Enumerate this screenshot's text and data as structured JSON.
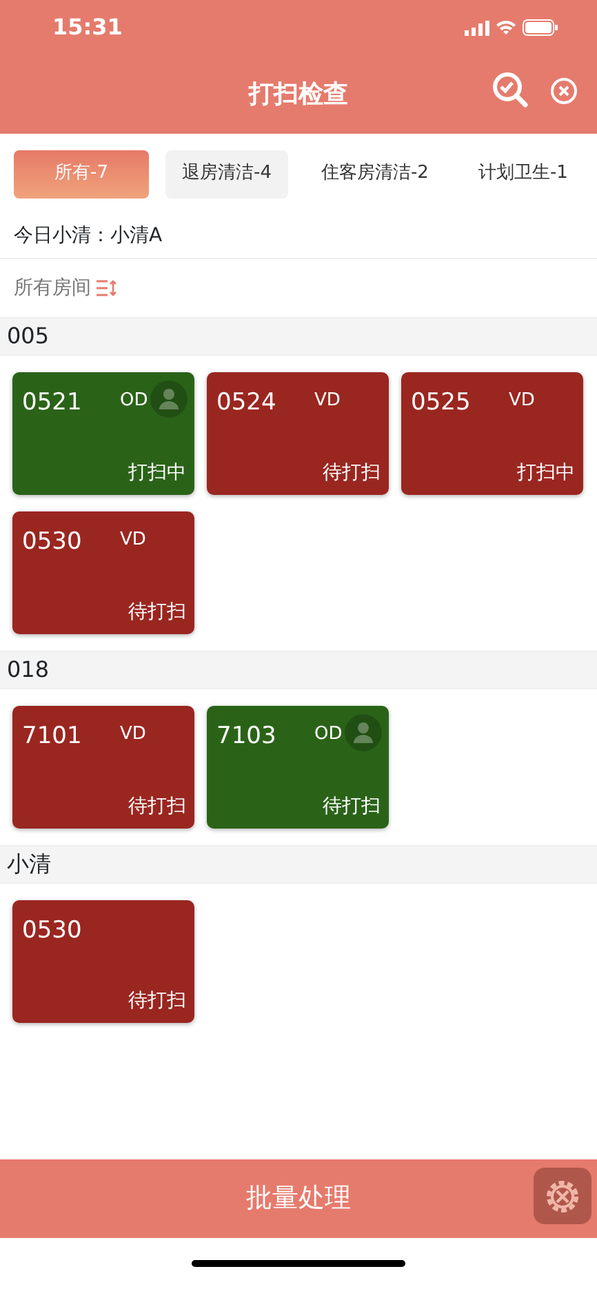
{
  "status_bar": {
    "time": "15:31"
  },
  "header": {
    "title": "打扫检查"
  },
  "tabs": [
    {
      "label": "所有-7",
      "selected": true
    },
    {
      "label": "退房清洁-4",
      "selected": false
    },
    {
      "label": "住客房清洁-2",
      "selected": false
    },
    {
      "label": "计划卫生-1",
      "selected": false
    }
  ],
  "today_cleaner": "今日小清：小清A",
  "filter": {
    "label": "所有房间"
  },
  "groups": [
    {
      "title": "005",
      "rooms": [
        {
          "number": "0521",
          "type": "OD",
          "status": "打扫中",
          "color": "#2a6318",
          "guest": true
        },
        {
          "number": "0524",
          "type": "VD",
          "status": "待打扫",
          "color": "#9a2620",
          "guest": false
        },
        {
          "number": "0525",
          "type": "VD",
          "status": "打扫中",
          "color": "#9a2620",
          "guest": false
        },
        {
          "number": "0530",
          "type": "VD",
          "status": "待打扫",
          "color": "#9a2620",
          "guest": false
        }
      ]
    },
    {
      "title": "018",
      "rooms": [
        {
          "number": "7101",
          "type": "VD",
          "status": "待打扫",
          "color": "#9a2620",
          "guest": false
        },
        {
          "number": "7103",
          "type": "OD",
          "status": "待打扫",
          "color": "#2a6318",
          "guest": true
        }
      ]
    },
    {
      "title": "小清",
      "rooms": [
        {
          "number": "0530",
          "status": "待打扫",
          "color": "#9a2620",
          "guest": false
        }
      ]
    }
  ],
  "bottom_button": "批量处理"
}
